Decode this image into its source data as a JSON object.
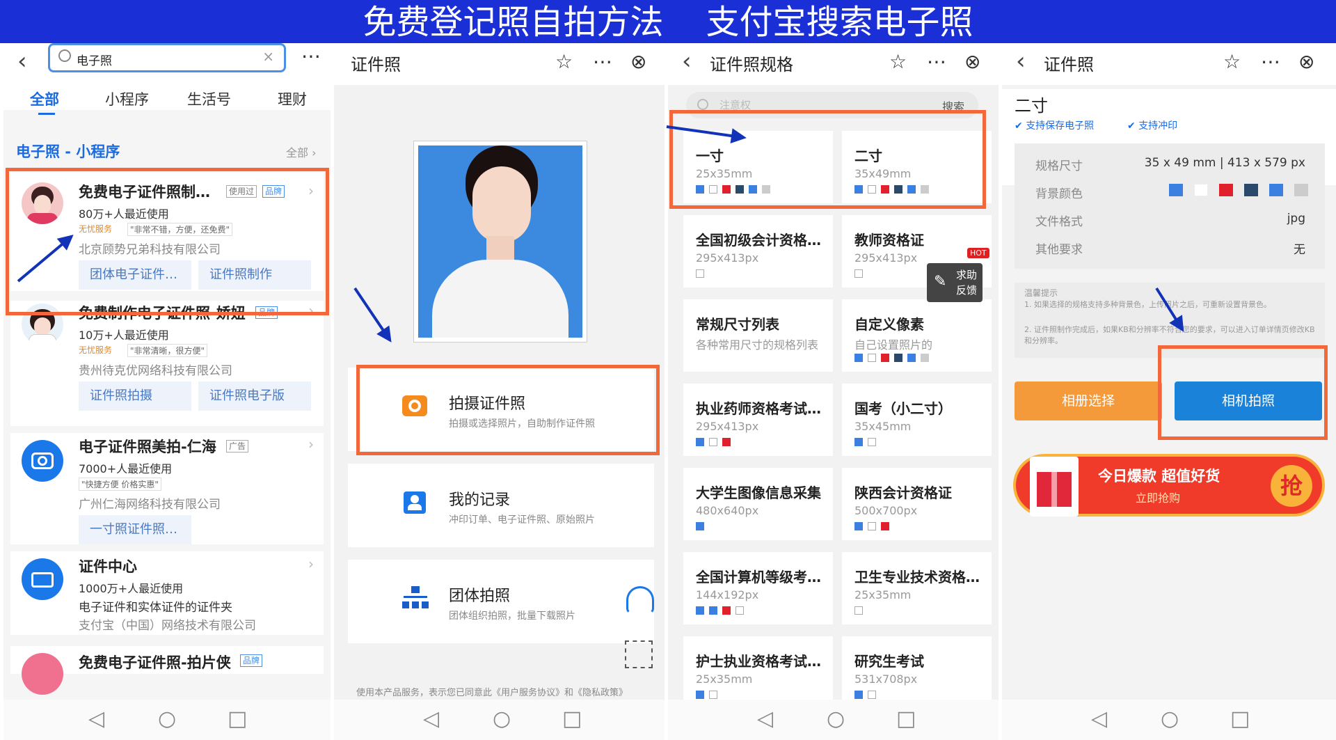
{
  "banner": {
    "title": "免费登记照自拍方法    支付宝搜索电子照"
  },
  "panel1": {
    "search_value": "电子照",
    "tabs": [
      "全部",
      "小程序",
      "生活号",
      "理财"
    ],
    "section_title": "电子照 - 小程序",
    "section_more": "全部",
    "results": [
      {
        "title": "免费电子证件照制…",
        "tags": [
          "使用过",
          "品牌"
        ],
        "users": "80万+人最近使用",
        "service": "无忧服务",
        "quote": "\"非常不错，方便，还免费\"",
        "company": "北京顾势兄弟科技有限公司",
        "chips": [
          "团体电子证件…",
          "证件照制作"
        ]
      },
      {
        "title": "免费制作电子证件照-娇妞",
        "tags": [
          "品牌"
        ],
        "users": "10万+人最近使用",
        "service": "无忧服务",
        "quote": "\"非常清晰，很方便\"",
        "company": "贵州待克优网络科技有限公司",
        "chips": [
          "证件照拍摄",
          "证件照电子版"
        ]
      },
      {
        "title": "电子证件照美拍-仁海",
        "tags": [
          "广告"
        ],
        "users": "7000+人最近使用",
        "quote": "\"快捷方便 价格实惠\"",
        "company": "广州仁海网络科技有限公司",
        "chips": [
          "一寸照证件照…"
        ]
      },
      {
        "title": "证件中心",
        "users": "1000万+人最近使用",
        "desc": "电子证件和实体证件的证件夹",
        "company": "支付宝（中国）网络技术有限公司"
      },
      {
        "title": "免费电子证件照-拍片侠",
        "tags": [
          "品牌"
        ]
      }
    ]
  },
  "panel2": {
    "title": "证件照",
    "menu": [
      {
        "title": "拍摄证件照",
        "sub": "拍摄或选择照片，自助制作证件照"
      },
      {
        "title": "我的记录",
        "sub": "冲印订单、电子证件照、原始照片"
      },
      {
        "title": "团体拍照",
        "sub": "团体组织拍照，批量下载照片"
      }
    ],
    "footer": "使用本产品服务，表示您已同意此《用户服务协议》和《隐私政策》"
  },
  "panel3": {
    "title": "证件照规格",
    "search_placeholder": "注意权",
    "search_btn": "搜索",
    "items": [
      {
        "name": "一寸",
        "dim": "25x35mm",
        "colors": [
          "#3b7fe0",
          "#ffffff",
          "#e0202a",
          "#2b4a6b",
          "#3b7fe0",
          "#cccccc"
        ]
      },
      {
        "name": "二寸",
        "dim": "35x49mm",
        "colors": [
          "#3b7fe0",
          "#ffffff",
          "#e0202a",
          "#2b4a6b",
          "#3b7fe0",
          "#cccccc"
        ]
      },
      {
        "name": "全国初级会计资格…",
        "dim": "295x413px",
        "colors": [
          "#ffffff"
        ]
      },
      {
        "name": "教师资格证",
        "dim": "295x413px",
        "colors": [
          "#ffffff"
        ]
      },
      {
        "name": "常规尺寸列表",
        "dim": "各种常用尺寸的规格列表",
        "colors": []
      },
      {
        "name": "自定义像素",
        "dim": "自己设置照片的",
        "colors": [
          "#3b7fe0",
          "#ffffff",
          "#e0202a",
          "#2b4a6b",
          "#3b7fe0",
          "#cccccc"
        ]
      },
      {
        "name": "执业药师资格考试…",
        "dim": "295x413px",
        "colors": [
          "#3b7fe0",
          "#ffffff",
          "#e0202a"
        ]
      },
      {
        "name": "国考（小二寸）",
        "dim": "35x45mm",
        "colors": [
          "#3b7fe0",
          "#ffffff"
        ]
      },
      {
        "name": "大学生图像信息采集",
        "dim": "480x640px",
        "colors": [
          "#3b7fe0"
        ]
      },
      {
        "name": "陕西会计资格证",
        "dim": "500x700px",
        "colors": [
          "#3b7fe0",
          "#ffffff",
          "#e0202a"
        ]
      },
      {
        "name": "全国计算机等级考…",
        "dim": "144x192px",
        "colors": [
          "#3b7fe0",
          "#3b7fe0",
          "#e0202a",
          "#ffffff"
        ]
      },
      {
        "name": "卫生专业技术资格…",
        "dim": "25x35mm",
        "colors": [
          "#ffffff"
        ]
      },
      {
        "name": "护士执业资格考试…",
        "dim": "25x35mm",
        "colors": [
          "#3b7fe0",
          "#ffffff"
        ]
      },
      {
        "name": "研究生考试",
        "dim": "531x708px",
        "colors": [
          "#3b7fe0",
          "#ffffff"
        ]
      }
    ],
    "hot": "HOT",
    "feedback": [
      "求助",
      "反馈"
    ]
  },
  "panel4": {
    "title": "证件照",
    "heading": "二寸",
    "badges": [
      "支持保存电子照",
      "支持冲印"
    ],
    "rows": [
      {
        "k": "规格尺寸",
        "v": "35 x 49 mm | 413 x 579 px"
      },
      {
        "k": "背景颜色",
        "v": ""
      },
      {
        "k": "文件格式",
        "v": "jpg"
      },
      {
        "k": "其他要求",
        "v": "无"
      }
    ],
    "bg_colors": [
      "#3b7fe0",
      "#ffffff",
      "#e0202a",
      "#2b4a6b",
      "#3b7fe0",
      "#cccccc"
    ],
    "tips_title": "温馨提示",
    "tips": [
      "1. 如果选择的规格支持多种背景色，上传照片之后，可重新设置背景色。",
      "2. 证件照制作完成后，如果KB和分辨率不符合您的要求，可以进入订单详情页修改KB和分辨率。"
    ],
    "btn_album": "相册选择",
    "btn_camera": "相机拍照",
    "promo_title": "今日爆款 超值好货",
    "promo_sub": "立即抢购",
    "promo_btn": "抢"
  }
}
